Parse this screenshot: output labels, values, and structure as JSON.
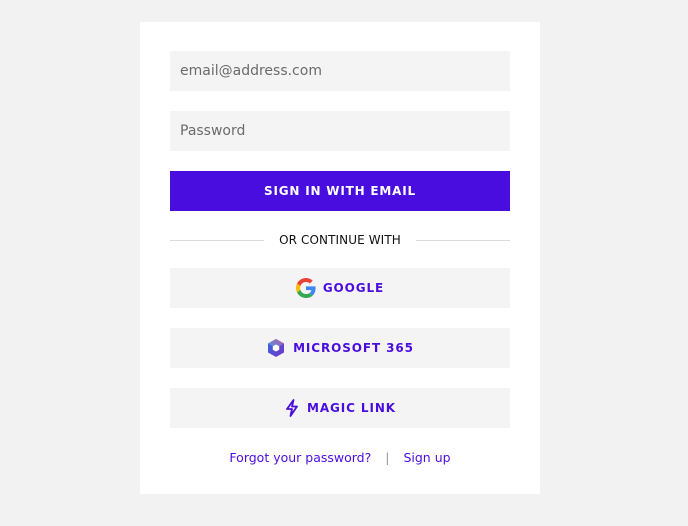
{
  "form": {
    "email_placeholder": "email@address.com",
    "password_placeholder": "Password",
    "submit_label": "SIGN IN WITH EMAIL"
  },
  "divider": {
    "label": "OR CONTINUE WITH"
  },
  "providers": [
    {
      "label": "GOOGLE",
      "icon": "google-icon"
    },
    {
      "label": "MICROSOFT 365",
      "icon": "microsoft-365-icon"
    },
    {
      "label": "MAGIC LINK",
      "icon": "lightning-icon"
    }
  ],
  "footer": {
    "forgot_password": "Forgot your password?",
    "separator": "|",
    "sign_up": "Sign up"
  },
  "colors": {
    "accent": "#4a0ddf",
    "background": "#f2f2f2",
    "input_bg": "#f4f4f4"
  }
}
